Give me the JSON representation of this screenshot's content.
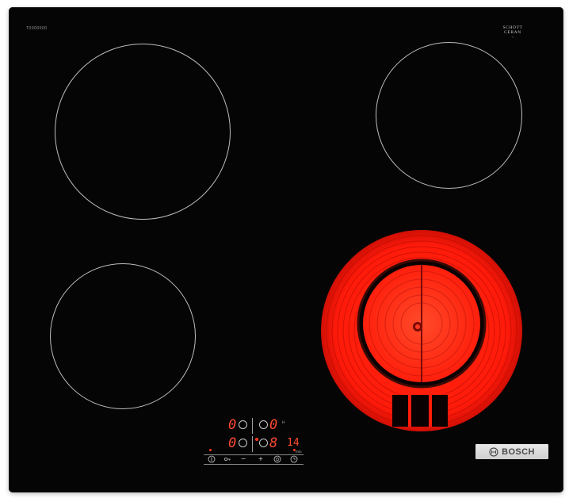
{
  "appliance": {
    "model_code": "T0000000",
    "glass_brand_line1": "SCHOTT",
    "glass_brand_line2": "CERAN",
    "glass_brand_sub": "®",
    "brand": "BOSCH",
    "heating_color": "#ff1a0a",
    "display_color": "#ff4a2e"
  },
  "controls": {
    "top_left_level": "0",
    "top_right_level": "0",
    "bottom_left_level": "0",
    "bottom_right_level": "8",
    "timer_value": "14",
    "timer_unit": "min",
    "buttons": {
      "power_icon": "power-icon",
      "childlock_icon": "key-icon",
      "minus_label": "−",
      "plus_label": "+",
      "timer_icon": "timer-icon",
      "clock_icon": "clock-icon"
    }
  }
}
